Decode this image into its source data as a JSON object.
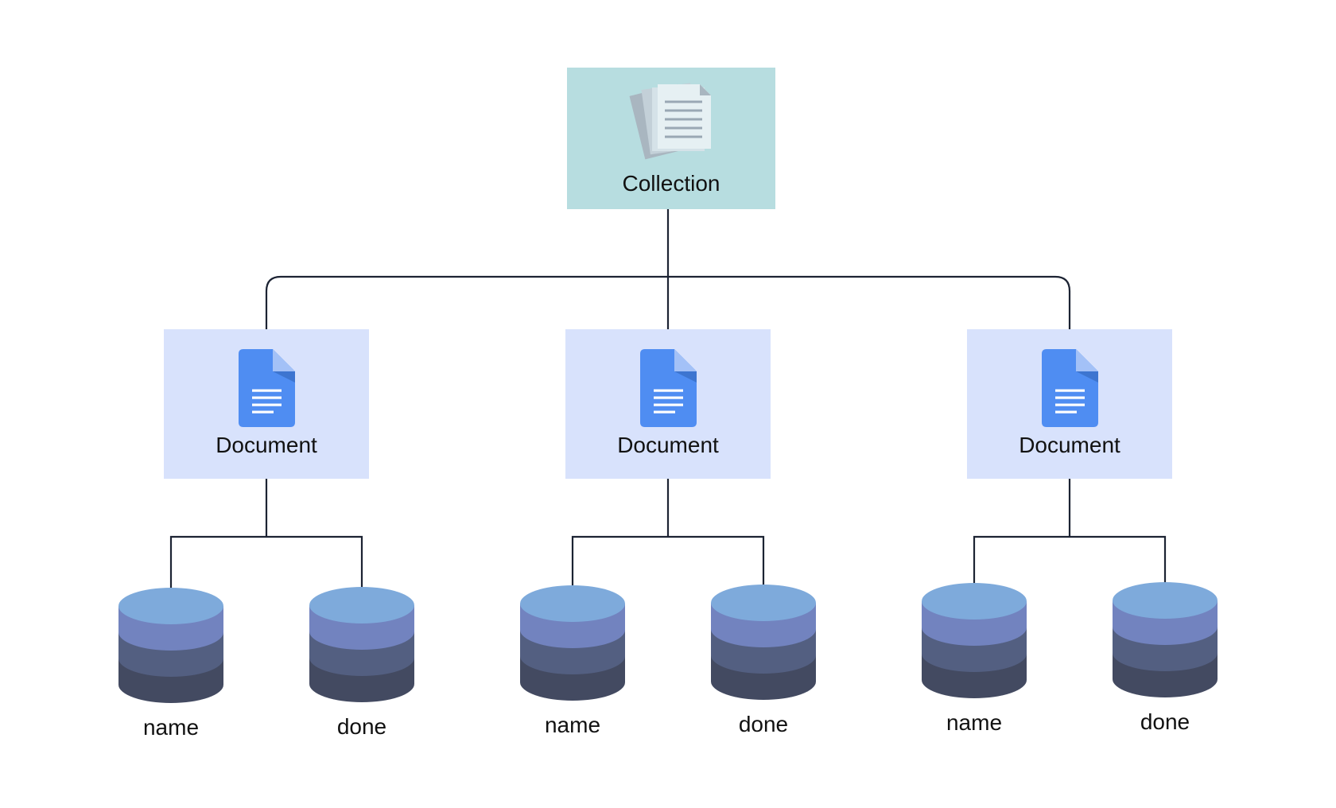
{
  "colors": {
    "collection_bg": "#b7dde0",
    "document_bg": "#d8e2fc",
    "connector": "#1c2333",
    "doc_icon_blue": "#4f8df2",
    "doc_icon_fold_light": "#a3c1f7",
    "doc_icon_fold_dark": "#3d75d0",
    "cylinder_top": "#7eaadb",
    "cylinder_band_1": "#7283bf",
    "cylinder_band_2": "#535f81",
    "cylinder_band_3": "#434a61",
    "collection_icon_page": "#e6f0f3",
    "collection_icon_back": "#a9b6c0",
    "collection_icon_lines": "#9aa8b4"
  },
  "root": {
    "label": "Collection",
    "icon": "document-stack-icon"
  },
  "documents": [
    {
      "label": "Document",
      "icon": "document-icon",
      "fields": [
        {
          "label": "name",
          "icon": "database-cylinder-icon"
        },
        {
          "label": "done",
          "icon": "database-cylinder-icon"
        }
      ]
    },
    {
      "label": "Document",
      "icon": "document-icon",
      "fields": [
        {
          "label": "name",
          "icon": "database-cylinder-icon"
        },
        {
          "label": "done",
          "icon": "database-cylinder-icon"
        }
      ]
    },
    {
      "label": "Document",
      "icon": "document-icon",
      "fields": [
        {
          "label": "name",
          "icon": "database-cylinder-icon"
        },
        {
          "label": "done",
          "icon": "database-cylinder-icon"
        }
      ]
    }
  ]
}
